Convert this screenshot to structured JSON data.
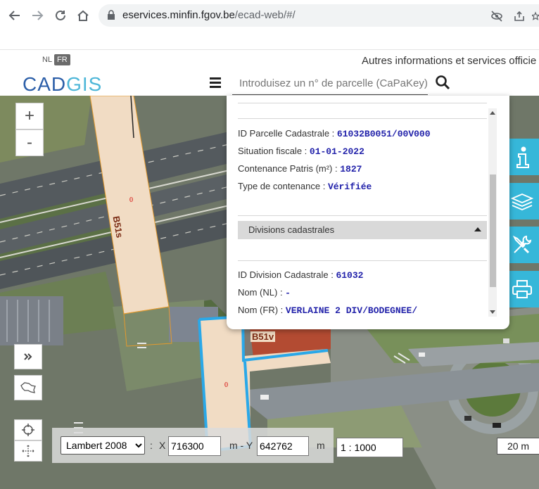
{
  "browser": {
    "url_host": "eservices.minfin.fgov.be",
    "url_path": "/ecad-web/#/"
  },
  "header": {
    "lang_nl": "NL",
    "lang_fr": "FR",
    "other_info": "Autres informations et services officie",
    "logo_cad": "CAD",
    "logo_gis": "GIS",
    "search_placeholder": "Introduisez un n° de parcelle (CaPaKey)"
  },
  "map": {
    "zoom_in": "+",
    "zoom_out": "-",
    "parcel_labels": [
      "B51s",
      "B51v"
    ],
    "parcel_numbers": [
      "0",
      "0"
    ]
  },
  "popup": {
    "fields": [
      {
        "label": "ID Parcelle Cadastrale : ",
        "value": "61032B0051/00V000"
      },
      {
        "label": "Situation fiscale : ",
        "value": "01-01-2022"
      },
      {
        "label": "Contenance Patris (m²) : ",
        "value": "1827"
      },
      {
        "label": "Type de contenance : ",
        "value": "Vérifiée"
      }
    ],
    "section_title": "Divisions cadastrales",
    "division_fields": [
      {
        "label": "ID Division Cadastrale : ",
        "value": "61032"
      },
      {
        "label": "Nom (NL) : ",
        "value": "-"
      },
      {
        "label": "Nom (FR) : ",
        "value": "VERLAINE 2 DIV/BODEGNEE/"
      }
    ]
  },
  "coords": {
    "crs": "Lambert 2008",
    "colon": ":",
    "x_label": "X",
    "x_value": "716300",
    "y_label": "m - Y",
    "y_value": "642762",
    "unit": "m",
    "scale": "1 : 1000",
    "scale_bar": "20 m"
  },
  "colors": {
    "accent": "#36b7d9",
    "logo_dark": "#2b5ea8",
    "logo_light": "#4db6d8",
    "parcel_fill": "#f1dcc4",
    "selected_outline": "#2aa8e8"
  }
}
